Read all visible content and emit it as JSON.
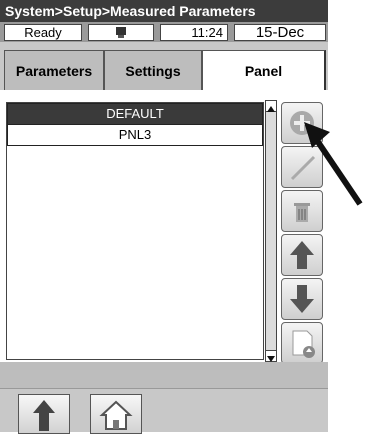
{
  "title": "System>Setup>Measured Parameters",
  "status": {
    "state": "Ready",
    "time": "11:24",
    "date": "15-Dec"
  },
  "tabs": [
    {
      "label": "Parameters"
    },
    {
      "label": "Settings"
    },
    {
      "label": "Panel",
      "active": true
    }
  ],
  "list": {
    "items": [
      {
        "label": "DEFAULT",
        "selected": true
      },
      {
        "label": "PNL3",
        "selected": false
      }
    ]
  },
  "side_buttons": [
    {
      "icon": "add-icon"
    },
    {
      "icon": "edit-icon"
    },
    {
      "icon": "trash-icon"
    },
    {
      "icon": "arrow-up-icon"
    },
    {
      "icon": "arrow-down-icon"
    },
    {
      "icon": "import-icon"
    },
    {
      "icon": "export-icon"
    }
  ],
  "bottom_buttons": [
    {
      "icon": "back-up-arrow-icon"
    },
    {
      "icon": "home-icon"
    }
  ],
  "colors": {
    "title_bg": "#3c3c3c",
    "selected_bg": "#3a3a3a",
    "panel_bg": "#bdbdbd",
    "arrow_up": "#555555"
  }
}
